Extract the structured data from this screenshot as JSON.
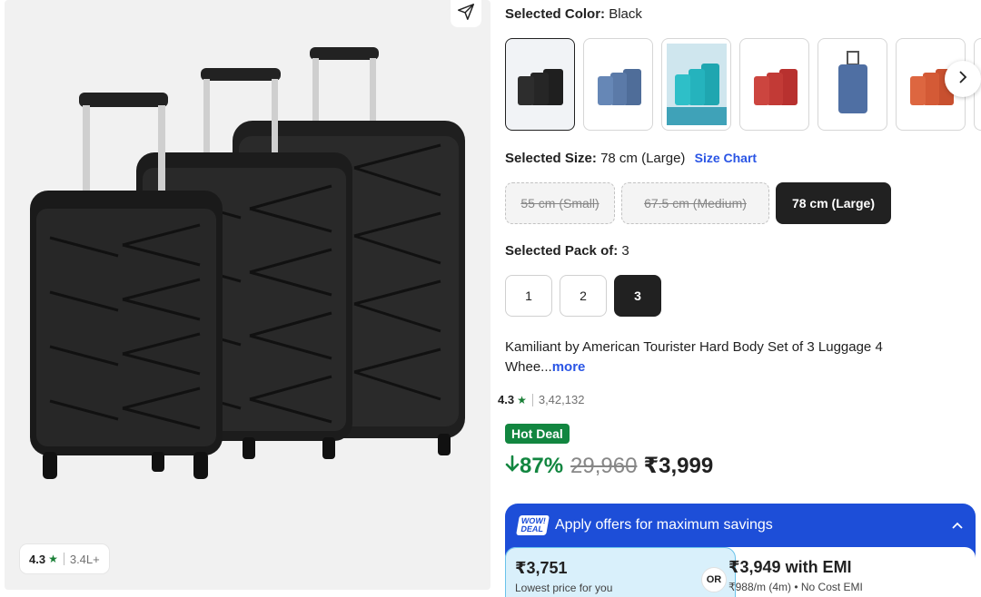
{
  "product_image": {
    "rating": "4.3",
    "rating_count": "3.4L+"
  },
  "color": {
    "label": "Selected Color:",
    "value": "Black",
    "swatches": [
      "Black",
      "Blue",
      "Teal",
      "Red",
      "Blue single",
      "Orange"
    ]
  },
  "size": {
    "label": "Selected Size:",
    "value": "78 cm (Large)",
    "size_chart": "Size Chart",
    "options": [
      "55 cm (Small)",
      "67.5 cm (Medium)",
      "78 cm (Large)"
    ]
  },
  "pack": {
    "label": "Selected Pack of:",
    "value": "3",
    "options": [
      "1",
      "2",
      "3"
    ]
  },
  "title": {
    "text": "Kamiliant by American Tourister Hard Body Set of 3 Luggage 4 Whee...",
    "more": "more"
  },
  "rating": {
    "value": "4.3",
    "count": "3,42,132"
  },
  "deal_badge": "Hot Deal",
  "price": {
    "discount": "87%",
    "mrp": "29,960",
    "selling": "₹3,999"
  },
  "offers": {
    "badge_line1": "WOW!",
    "badge_line2": "DEAL",
    "heading": "Apply offers for maximum savings",
    "lowest_price": "₹3,751",
    "lowest_label": "Lowest price for you",
    "or_label": "OR",
    "emi_price": "₹3,949 with EMI",
    "emi_detail": "₹988/m (4m) • No Cost EMI"
  },
  "colors": {
    "green": "#128640",
    "blue_link": "#2a55e5",
    "offer_blue": "#1d4ed8",
    "dark": "#212121"
  }
}
